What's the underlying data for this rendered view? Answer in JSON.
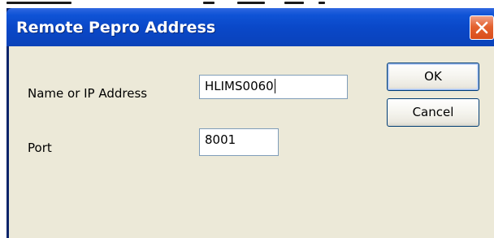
{
  "dialog": {
    "title": "Remote Pepro Address"
  },
  "form": {
    "name_label": "Name or IP Address",
    "name_value": "HLIMS0060",
    "port_label": "Port",
    "port_value": "8001"
  },
  "buttons": {
    "ok_label": "OK",
    "cancel_label": "Cancel"
  },
  "colors": {
    "titlebar": "#0a48c8",
    "client": "#ece9d8",
    "close": "#e4622f"
  },
  "icons": {
    "close": "close-icon"
  }
}
